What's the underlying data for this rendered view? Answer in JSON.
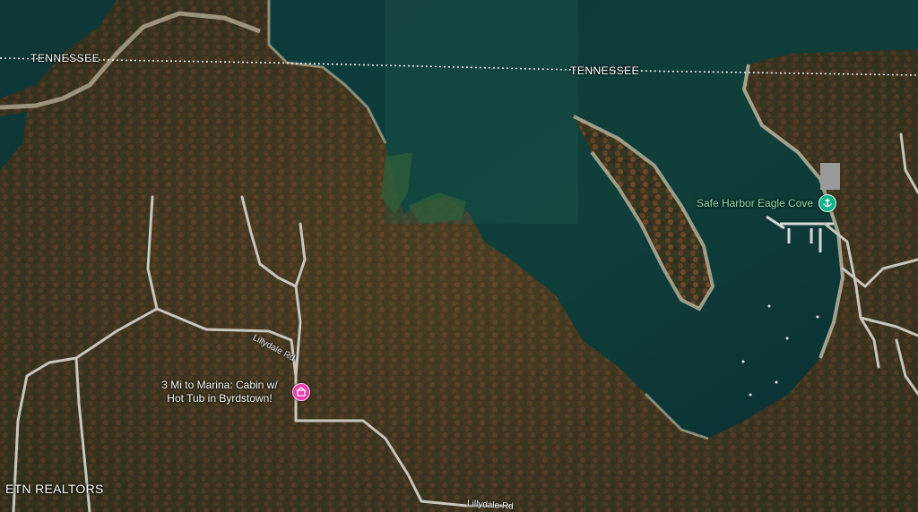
{
  "map": {
    "state_labels": [
      "TENNESSEE",
      "TENNESSEE"
    ],
    "poi": {
      "name": "Safe Harbor Eagle Cove",
      "icon": "marina-icon",
      "color": "#13b38a"
    },
    "listing": {
      "label": "3 Mi to Marina: Cabin w/ Hot Tub in Byrdstown!",
      "icon": "listing-pin-icon",
      "color": "#e83fb0"
    },
    "roads": [
      "Lillydale Rd",
      "Lillydale Rd"
    ],
    "attribution": "ETN REALTORS",
    "colors": {
      "water": "#0f3b36",
      "forest": "#4a3a22",
      "shore": "#cfc7ad",
      "road": "#c9c6bd",
      "border": "#ffffff"
    }
  }
}
